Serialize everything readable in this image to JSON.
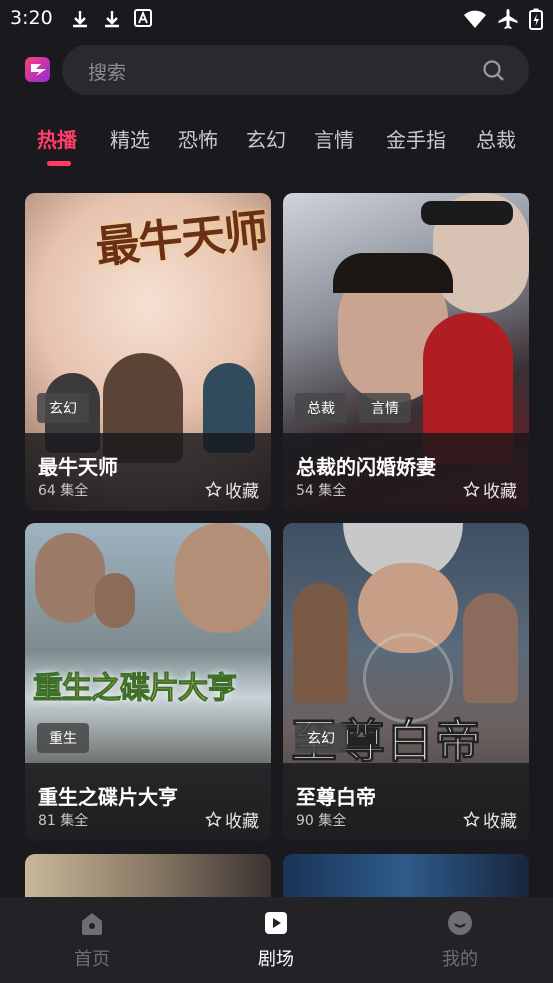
{
  "status_bar": {
    "time": "3:20"
  },
  "search": {
    "placeholder": "搜索"
  },
  "tabs": [
    {
      "label": "热播",
      "active": true
    },
    {
      "label": "精选"
    },
    {
      "label": "恐怖"
    },
    {
      "label": "玄幻"
    },
    {
      "label": "言情"
    },
    {
      "label": "金手指"
    },
    {
      "label": "总裁"
    }
  ],
  "cards": [
    {
      "title": "最牛天师",
      "episodes": "64 集全",
      "tags": [
        "玄幻"
      ],
      "poster_text": "最牛天师",
      "fav_label": "收藏"
    },
    {
      "title": "总裁的闪婚娇妻",
      "episodes": "54 集全",
      "tags": [
        "总裁",
        "言情"
      ],
      "fav_label": "收藏"
    },
    {
      "title": "重生之碟片大亨",
      "episodes": "81 集全",
      "tags": [
        "重生"
      ],
      "poster_text": "重生之碟片大亨",
      "fav_label": "收藏"
    },
    {
      "title": "至尊白帝",
      "episodes": "90 集全",
      "tags": [
        "玄幻"
      ],
      "poster_text": "至尊白帝",
      "fav_label": "收藏"
    }
  ],
  "bottom_nav": [
    {
      "label": "首页",
      "icon": "home-icon"
    },
    {
      "label": "剧场",
      "icon": "theater-icon",
      "active": true
    },
    {
      "label": "我的",
      "icon": "profile-icon"
    }
  ],
  "colors": {
    "accent": "#ff3d6a",
    "background": "#1a1a1e",
    "search_bg": "#2a2a2e"
  }
}
